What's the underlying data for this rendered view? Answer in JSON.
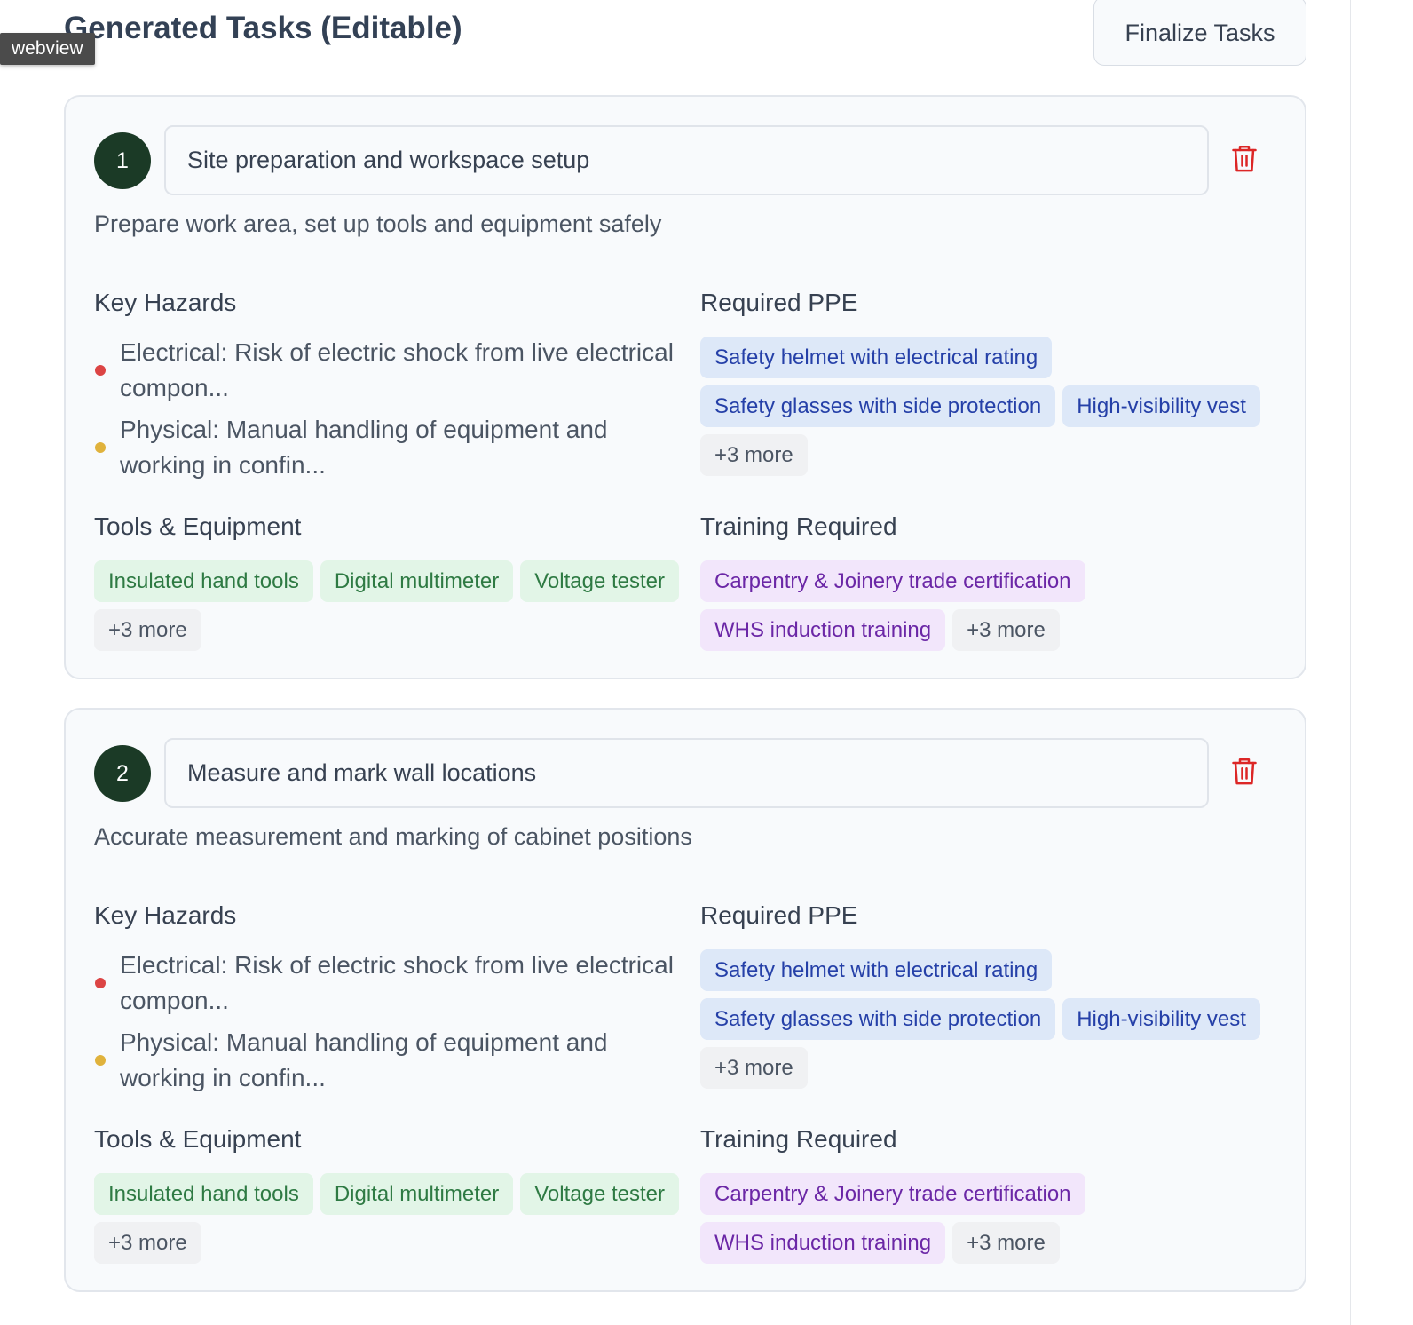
{
  "header": {
    "title": "Generated Tasks (Editable)",
    "finalize_label": "Finalize Tasks",
    "webview_label": "webview"
  },
  "tasks": [
    {
      "number": "1",
      "title": "Site preparation and workspace setup",
      "description": "Prepare work area, set up tools and equipment safely",
      "hazards_label": "Key Hazards",
      "hazards": [
        {
          "text": "Electrical: Risk of electric shock from live electrical compon...",
          "color": "#dc4444"
        },
        {
          "text": "Physical: Manual handling of equipment and working in confin...",
          "color": "#e0b23c"
        }
      ],
      "ppe_label": "Required PPE",
      "ppe": [
        "Safety helmet with electrical rating",
        "Safety glasses with side protection",
        "High-visibility vest"
      ],
      "ppe_more": "+3 more",
      "tools_label": "Tools & Equipment",
      "tools": [
        "Insulated hand tools",
        "Digital multimeter",
        "Voltage tester"
      ],
      "tools_more": "+3 more",
      "training_label": "Training Required",
      "training": [
        "Carpentry & Joinery trade certification",
        "WHS induction training"
      ],
      "training_more": "+3 more"
    },
    {
      "number": "2",
      "title": "Measure and mark wall locations",
      "description": "Accurate measurement and marking of cabinet positions",
      "hazards_label": "Key Hazards",
      "hazards": [
        {
          "text": "Electrical: Risk of electric shock from live electrical compon...",
          "color": "#dc4444"
        },
        {
          "text": "Physical: Manual handling of equipment and working in confin...",
          "color": "#e0b23c"
        }
      ],
      "ppe_label": "Required PPE",
      "ppe": [
        "Safety helmet with electrical rating",
        "Safety glasses with side protection",
        "High-visibility vest"
      ],
      "ppe_more": "+3 more",
      "tools_label": "Tools & Equipment",
      "tools": [
        "Insulated hand tools",
        "Digital multimeter",
        "Voltage tester"
      ],
      "tools_more": "+3 more",
      "training_label": "Training Required",
      "training": [
        "Carpentry & Joinery trade certification",
        "WHS induction training"
      ],
      "training_more": "+3 more"
    }
  ],
  "colors": {
    "accent_dark_green": "#1b3a26",
    "delete_red": "#dc2626",
    "hazard_high": "#dc4444",
    "hazard_medium": "#e0b23c"
  },
  "icons": {
    "delete": "trash-icon"
  }
}
